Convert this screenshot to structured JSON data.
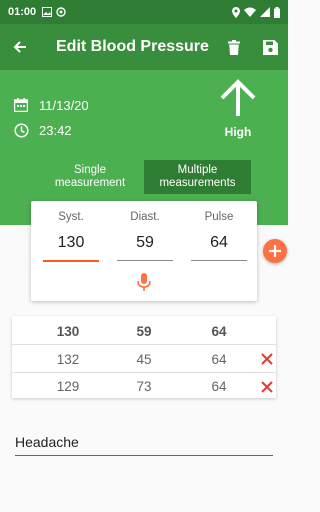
{
  "status_bar": {
    "time": "01:00"
  },
  "app_bar": {
    "title": "Edit Blood Pressure"
  },
  "record": {
    "date": "11/13/20",
    "time": "23:42",
    "level_label": "High"
  },
  "mode_toggle": {
    "single_label": "Single\nmeasurement",
    "multiple_label": "Multiple\nmeasurements",
    "selected": "multiple"
  },
  "entry": {
    "syst_label": "Syst.",
    "diast_label": "Diast.",
    "pulse_label": "Pulse",
    "syst_value": "130",
    "diast_value": "59",
    "pulse_value": "64"
  },
  "measurements": {
    "header": {
      "syst": "130",
      "diast": "59",
      "pulse": "64"
    },
    "rows": [
      {
        "syst": "132",
        "diast": "45",
        "pulse": "64"
      },
      {
        "syst": "129",
        "diast": "73",
        "pulse": "64"
      }
    ]
  },
  "note": {
    "value": "Headache"
  },
  "colors": {
    "status_bar": "#2e7d32",
    "app_bar": "#388e3c",
    "hero": "#4caf50",
    "accent": "#ff7043",
    "delete": "#e53935"
  },
  "icons": {
    "back": "arrow-left-icon",
    "delete": "trash-icon",
    "save": "save-icon",
    "calendar": "calendar-icon",
    "clock": "clock-icon",
    "level": "arrow-up-icon",
    "mic": "microphone-icon",
    "add": "plus-icon",
    "row_delete": "close-icon"
  }
}
